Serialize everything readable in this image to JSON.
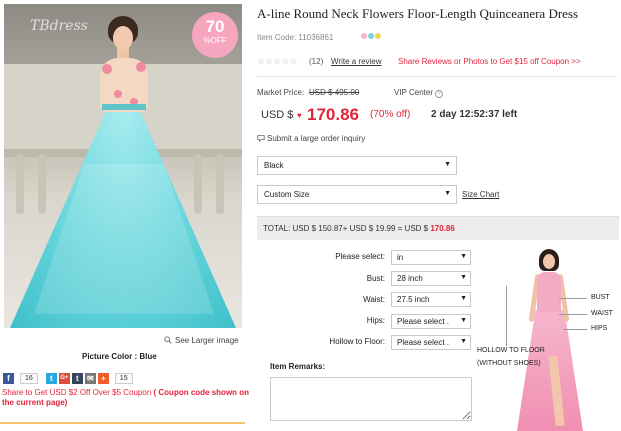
{
  "product": {
    "badge_percent": "70",
    "badge_off": "%OFF",
    "watermark": "TBdress",
    "title": "A-line Round Neck Flowers Floor-Length Quinceanera Dress",
    "item_code": "Item Code: 11036861",
    "color_dots": [
      "#f7b5cf",
      "#79d6dc",
      "#f2d55b"
    ],
    "stars": "☆☆☆☆☆",
    "review_count": "(12)",
    "write_review": "Write a review",
    "share_reviews": "Share Reviews or Photos to Get $15 off Coupon >>",
    "market_price_label": "Market Price:",
    "market_price_value": "USD $ 495.00",
    "vip_center": "VIP Center",
    "vip_help": "?",
    "currency_label": "USD $",
    "currency_mark": "♥",
    "price": "170.86",
    "percent_off": "(70% off)",
    "countdown": "2 day 12:52:37 left",
    "bulk_inquiry": "Submit a large order inquiry"
  },
  "left": {
    "see_larger": "See Larger image",
    "picture_color": "Picture Color : Blue",
    "social": [
      {
        "icon": "facebook-icon",
        "glyph": "f",
        "color": "#3b5998"
      },
      {
        "icon": "twitter-icon",
        "glyph": "t",
        "color": "#2aa9e0"
      },
      {
        "icon": "googleplus-icon",
        "glyph": "G+",
        "color": "#dd4b39"
      },
      {
        "icon": "tumblr-icon",
        "glyph": "t",
        "color": "#36465d"
      },
      {
        "icon": "email-icon",
        "glyph": "✉",
        "color": "#777777"
      },
      {
        "icon": "addthis-icon",
        "glyph": "+",
        "color": "#f15b2a"
      }
    ],
    "facebook_count": "16",
    "share_count": "15",
    "share_text_a": "Share to Get USD $2 Off Over $5 Coupon",
    "share_text_b": "( Coupon code shown on the current page)"
  },
  "options": {
    "color_select": "Black",
    "size_select": "Custom Size",
    "size_chart": "Size Chart"
  },
  "total": {
    "prefix": "TOTAL: USD $ 150.87+ USD $ 19.99 = USD $",
    "value": "170.86"
  },
  "form": {
    "please_select_label": "Please select:",
    "please_select_value": "in",
    "bust_label": "Bust:",
    "bust_value": "28 inch",
    "waist_label": "Waist:",
    "waist_value": "27.5 inch",
    "hips_label": "Hips:",
    "hips_value": "Please select .",
    "hollow_label": "Hollow to Floor:",
    "hollow_value": "Please select .",
    "remarks_label": "Item Remarks:"
  },
  "diagram": {
    "bust": "BUST",
    "waist": "WAIST",
    "hips": "HIPS",
    "hollow_line1": "HOLLOW TO FLOOR",
    "hollow_line2": "(WITHOUT SHOES)"
  },
  "colors": {
    "accent_red": "#e2243b",
    "dress_blue": "#6fd9df",
    "badge_pink": "#f6a6bf"
  }
}
